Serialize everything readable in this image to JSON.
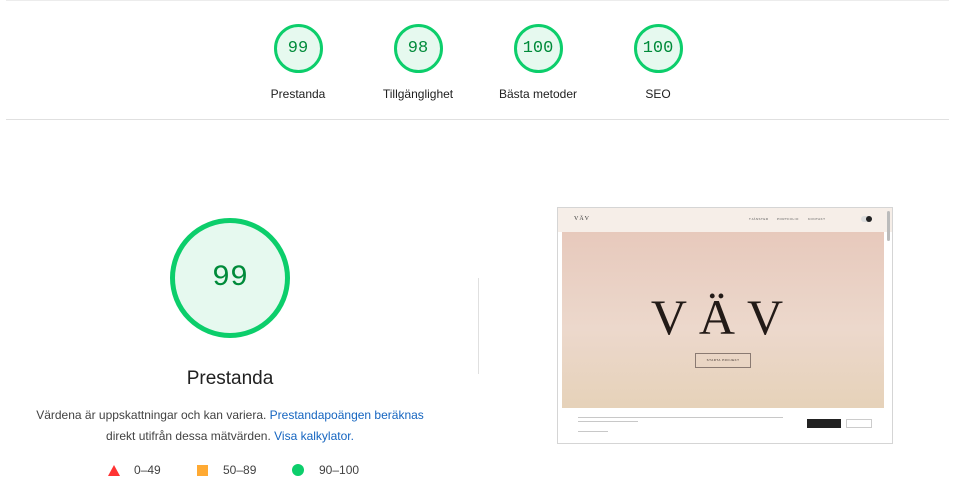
{
  "summary": {
    "gauges": [
      {
        "score": "99",
        "label": "Prestanda"
      },
      {
        "score": "98",
        "label": "Tillgänglighet"
      },
      {
        "score": "100",
        "label": "Bästa metoder"
      },
      {
        "score": "100",
        "label": "SEO"
      }
    ]
  },
  "performance": {
    "score": "99",
    "title": "Prestanda",
    "desc_text_1": "Värdena är uppskattningar och kan variera.",
    "desc_link_1": "Prestandapoängen beräknas",
    "desc_text_2": "direkt utifrån dessa mätvärden.",
    "desc_link_2": "Visa kalkylator."
  },
  "legend": [
    {
      "range": "0–49",
      "color": "#ff3333",
      "icon": "triangle-icon"
    },
    {
      "range": "50–89",
      "color": "#ffaa33",
      "icon": "square-icon"
    },
    {
      "range": "90–100",
      "color": "#0cce6b",
      "icon": "circle-icon"
    }
  ],
  "screenshot": {
    "brand": "VÄV",
    "nav_items": [
      "TJÄNSTER",
      "PORTFOLIO",
      "KONTAKT"
    ],
    "hero_title": "VÄV",
    "hero_button": "STARTA PROJEKT"
  },
  "colors": {
    "pass": "#0cce6b",
    "average": "#ffaa33",
    "fail": "#ff3333",
    "link": "#1565c0"
  }
}
